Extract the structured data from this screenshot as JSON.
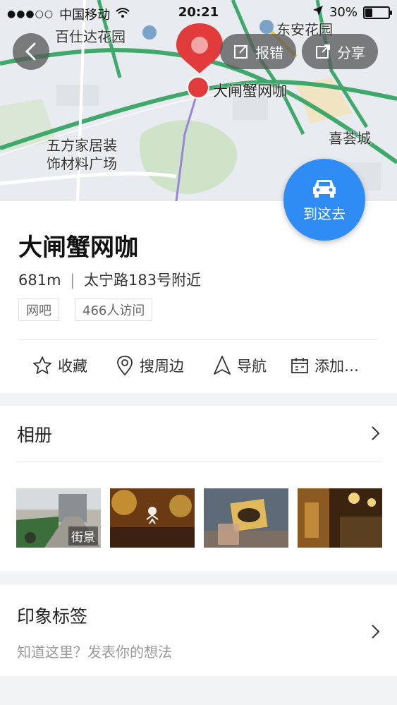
{
  "status_bar": {
    "signal_dots": "●●●○○",
    "carrier": "中国移动",
    "time": "20:21",
    "battery_percent": "30%"
  },
  "map": {
    "labels": {
      "baishida": "百仕达花园",
      "dongan": "东安花园",
      "wufang_line1": "五方家居装",
      "wufang_line2": "饰材料广场",
      "xihui": "喜荟城",
      "pin_label": "大闸蟹网咖"
    },
    "buttons": {
      "report": "报错",
      "share": "分享"
    },
    "go_label": "到这去"
  },
  "place": {
    "name": "大闸蟹网咖",
    "distance": "681m",
    "address": "太宁路183号附近",
    "tags": [
      "网吧",
      "466人访问"
    ],
    "actions": [
      {
        "label": "收藏",
        "icon": "star-icon"
      },
      {
        "label": "搜周边",
        "icon": "location-search-icon"
      },
      {
        "label": "导航",
        "icon": "navigation-arrow-icon"
      },
      {
        "label": "添加…",
        "icon": "calendar-icon"
      }
    ]
  },
  "album": {
    "title": "相册",
    "photos": [
      {
        "caption": "街景"
      },
      {
        "caption": ""
      },
      {
        "caption": ""
      },
      {
        "caption": ""
      }
    ]
  },
  "impression": {
    "title": "印象标签",
    "hint": "知道这里？发表你的想法"
  },
  "colors": {
    "accent": "#2f8cf4",
    "pin_red": "#e23b3b",
    "road_green": "#3ea96b"
  }
}
